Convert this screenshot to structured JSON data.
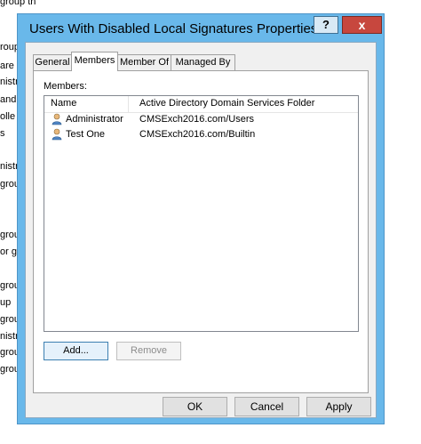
{
  "background_window": {
    "lines": [
      "group th",
      "roups O",
      "are p",
      "nistr",
      "and",
      "olle",
      "s",
      "nistr",
      "grou",
      "grou",
      "or g",
      "grou",
      "up",
      "grou",
      "nistr",
      "grou",
      "grou"
    ]
  },
  "dialog": {
    "title": "Users With Disabled Local Signatures Properties",
    "help_label": "?",
    "close_label": "x",
    "tabs": [
      {
        "label": "General"
      },
      {
        "label": "Members"
      },
      {
        "label": "Member Of"
      },
      {
        "label": "Managed By"
      }
    ],
    "active_tab": "Members",
    "members_label": "Members:",
    "columns": [
      "Name",
      "Active Directory Domain Services Folder"
    ],
    "members": [
      {
        "name": "Administrator",
        "folder": "CMSExch2016.com/Users",
        "icon": "user-icon"
      },
      {
        "name": "Test One",
        "folder": "CMSExch2016.com/Builtin",
        "icon": "user-icon"
      }
    ],
    "add_label": "Add...",
    "remove_label": "Remove",
    "ok_label": "OK",
    "cancel_label": "Cancel",
    "apply_label": "Apply"
  }
}
